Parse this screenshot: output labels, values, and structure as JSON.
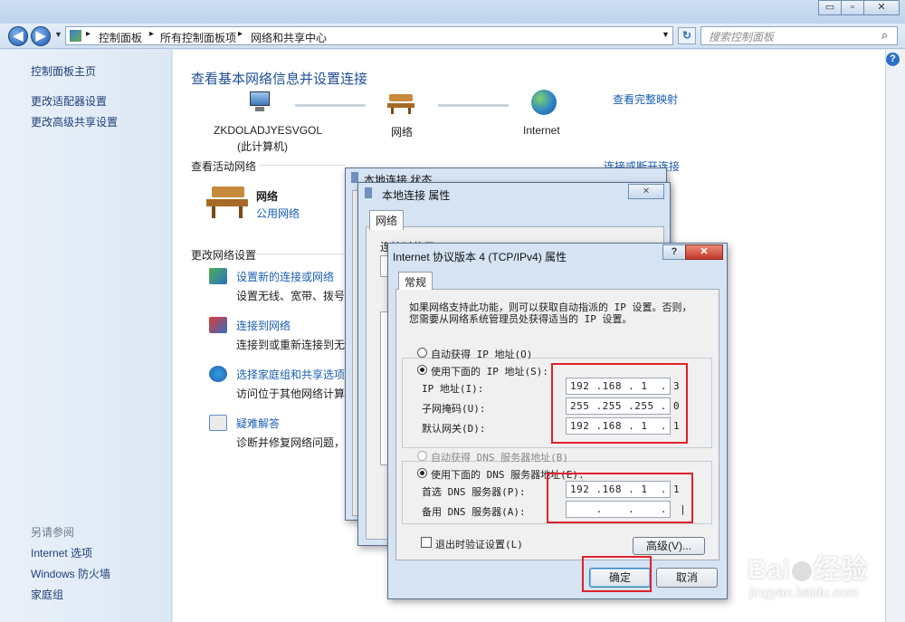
{
  "window": {
    "min": "▭",
    "max": "▫",
    "close": "✕"
  },
  "breadcrumb": {
    "items": [
      "控制面板",
      "所有控制面板项",
      "网络和共享中心"
    ]
  },
  "search": {
    "placeholder": "搜索控制面板"
  },
  "sidebar": {
    "home": "控制面板主页",
    "items": [
      "更改适配器设置",
      "更改高级共享设置"
    ],
    "see_also_title": "另请参阅",
    "see_also": [
      "Internet 选项",
      "Windows 防火墙",
      "家庭组"
    ]
  },
  "main": {
    "title": "查看基本网络信息并设置连接",
    "full_map": "查看完整映射",
    "computer_name": "ZKDOLADJYESVGOL",
    "computer_sub": "(此计算机)",
    "network_label": "网络",
    "internet_label": "Internet",
    "active_heading": "查看活动网络",
    "connect_disconnect": "连接或断开连接",
    "active_name": "网络",
    "active_type": "公用网络",
    "change_heading": "更改网络设置",
    "tasks": [
      {
        "title": "设置新的连接或网络",
        "desc": "设置无线、宽带、拨号、"
      },
      {
        "title": "连接到网络",
        "desc": "连接到或重新连接到无线"
      },
      {
        "title": "选择家庭组和共享选项",
        "desc": "访问位于其他网络计算机"
      },
      {
        "title": "疑难解答",
        "desc": "诊断并修复网络问题，或"
      }
    ]
  },
  "status_dialog": {
    "title": "本地连接 状态"
  },
  "props_dialog": {
    "title": "本地连接 属性",
    "tab": "网络",
    "line1": "连接时使用:",
    "close": "✕"
  },
  "tcp_dialog": {
    "title": "Internet 协议版本 4 (TCP/IPv4) 属性",
    "help": "?",
    "close": "✕",
    "tab": "常规",
    "desc1": "如果网络支持此功能，则可以获取自动指派的 IP 设置。否则，",
    "desc2": "您需要从网络系统管理员处获得适当的 IP 设置。",
    "auto_ip": "自动获得 IP 地址(O)",
    "manual_ip": "使用下面的 IP 地址(S):",
    "ip_label": "IP 地址(I):",
    "ip_value": "192 .168 . 1  . 3",
    "mask_label": "子网掩码(U):",
    "mask_value": "255 .255 .255 . 0",
    "gw_label": "默认网关(D):",
    "gw_value": "192 .168 . 1  . 1",
    "auto_dns": "自动获得 DNS 服务器地址(B)",
    "manual_dns": "使用下面的 DNS 服务器地址(E):",
    "dns1_label": "首选 DNS 服务器(P):",
    "dns1_value": "192 .168 . 1  . 1",
    "dns2_label": "备用 DNS 服务器(A):",
    "dns2_value": "    .    .    .  |",
    "validate": "退出时验证设置(L)",
    "advanced": "高级(V)...",
    "ok": "确定",
    "cancel": "取消"
  },
  "watermark": {
    "brand": "Bai",
    "brand2": "经验",
    "url": "jingyan.baidu.com"
  }
}
